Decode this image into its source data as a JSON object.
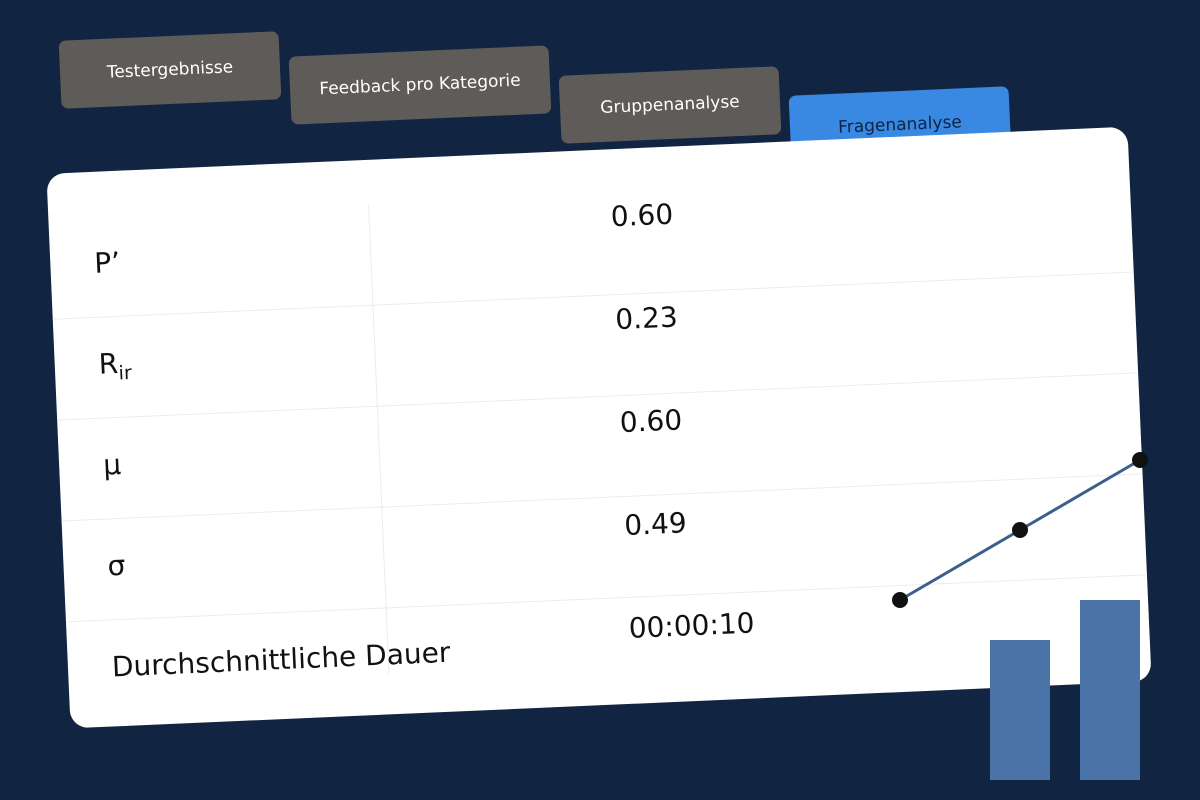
{
  "tabs": [
    {
      "label": "Testergebnisse",
      "active": false
    },
    {
      "label": "Feedback pro Kategorie",
      "active": false
    },
    {
      "label": "Gruppenanalyse",
      "active": false
    },
    {
      "label": "Fragenanalyse",
      "active": true
    }
  ],
  "stats": {
    "rows": [
      {
        "label": "P’",
        "value": "0.60"
      },
      {
        "label_main": "R",
        "label_sub": "ir",
        "value": "0.23"
      },
      {
        "label": "μ",
        "value": "0.60"
      },
      {
        "label": "σ",
        "value": "0.49"
      },
      {
        "label": "Durchschnittliche Dauer",
        "value": "00:00:10"
      }
    ]
  },
  "decoration": {
    "line_color": "#3d5f8b",
    "bar_color": "#4a74a8",
    "point_color": "#111111",
    "icon": "line-bar-chart-icon"
  },
  "colors": {
    "background": "#112542",
    "tab_inactive": "#5f5b58",
    "tab_active": "#3988e1",
    "card": "#ffffff"
  }
}
